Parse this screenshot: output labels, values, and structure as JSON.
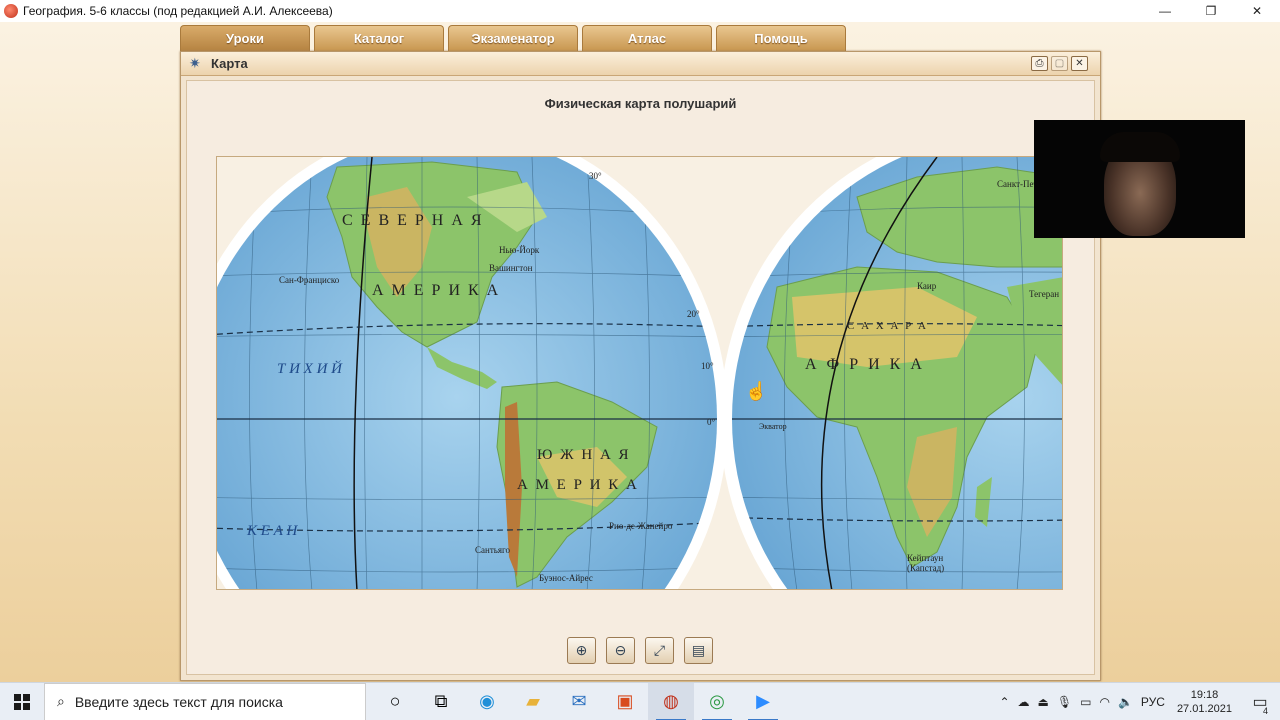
{
  "window": {
    "title": "География. 5-6 классы (под редакцией А.И. Алексеева)",
    "minimize": "—",
    "restore": "❐",
    "close": "✕"
  },
  "tabs": [
    {
      "label": "Уроки"
    },
    {
      "label": "Каталог"
    },
    {
      "label": "Экзаменатор"
    },
    {
      "label": "Атлас"
    },
    {
      "label": "Помощь"
    }
  ],
  "map_window": {
    "title": "Карта",
    "map_title": "Физическая карта полушарий",
    "btn_print": "⎙",
    "btn_max": "▢",
    "btn_close": "✕"
  },
  "map_labels": {
    "north_america": "С Е В Е Р Н А Я",
    "america1": "А М Е Р И К А",
    "south_america": "Ю Ж Н А Я",
    "america2": "А М Е Р И К А",
    "africa": "А Ф Р И К А",
    "sahara": "С А Х А Р А",
    "pacific_a": "Т  И  Х  И  Й",
    "pacific_b": "К  Е  А  Н",
    "san_francisco": "Сан-Франциско",
    "newyork": "Нью-Йорк",
    "washington": "Вашингтон",
    "rio": "Рио-де-Жанейро",
    "santiago": "Сантьяго",
    "buenos": "Буэнос-Айрес",
    "capetown": "Кейптаун",
    "capetown2": "(Капстад)",
    "cairo": "Каир",
    "tehran": "Тегеран",
    "petersburg": "Санкт-Петербург",
    "equator": "Экватор",
    "lat_30": "30°",
    "lat_20": "20°",
    "lat_10": "10°",
    "lat_0": "0°"
  },
  "zoom_buttons": [
    {
      "icon": "zoom-in-icon",
      "glyph": "⊕"
    },
    {
      "icon": "zoom-out-icon",
      "glyph": "⊖"
    },
    {
      "icon": "fit-icon",
      "glyph": "⤢"
    },
    {
      "icon": "scroll-icon",
      "glyph": "▤"
    }
  ],
  "taskbar": {
    "search_placeholder": "Введите здесь текст для поиска",
    "lang": "РУС",
    "time": "19:18",
    "date": "27.01.2021",
    "notifications": "4"
  }
}
